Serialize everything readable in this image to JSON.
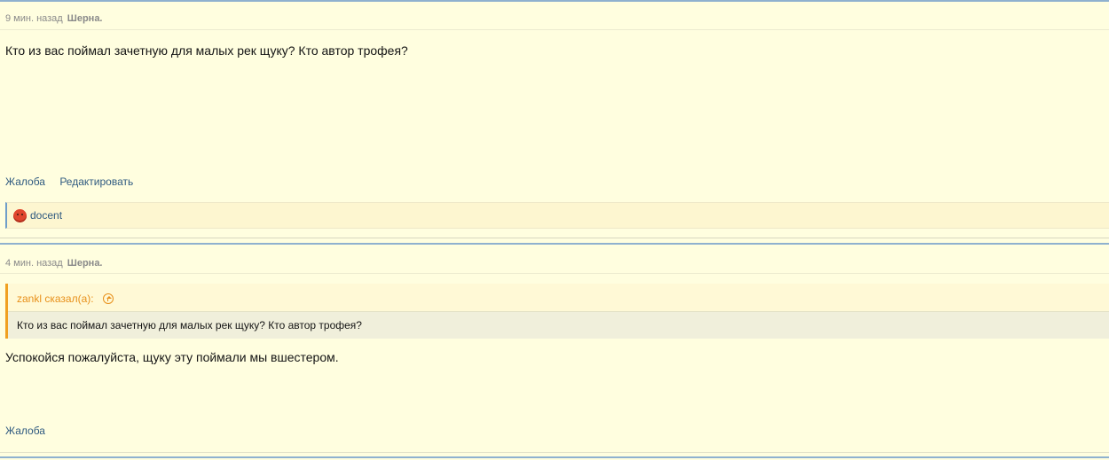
{
  "posts": [
    {
      "time": "9 мин. назад",
      "author": "Шерна.",
      "text": "Кто из вас поймал зачетную для малых рек щуку? Кто автор трофея?",
      "actions": {
        "report": "Жалоба",
        "edit": "Редактировать"
      },
      "reaction": {
        "icon": "angry-face-icon",
        "user": "docent"
      }
    },
    {
      "time": "4 мин. назад",
      "author": "Шерна.",
      "quote": {
        "header": "zankl сказал(а):",
        "text": "Кто из вас поймал зачетную для малых рек щуку? Кто автор трофея?"
      },
      "text": "Успокойся пожалуйста, щуку эту поймали мы вшестером.",
      "actions": {
        "report": "Жалоба"
      }
    }
  ],
  "colors": {
    "background": "#fffedf",
    "link": "#2f5a80",
    "quote_accent": "#f0a020",
    "post_border": "#8fb1cf"
  }
}
